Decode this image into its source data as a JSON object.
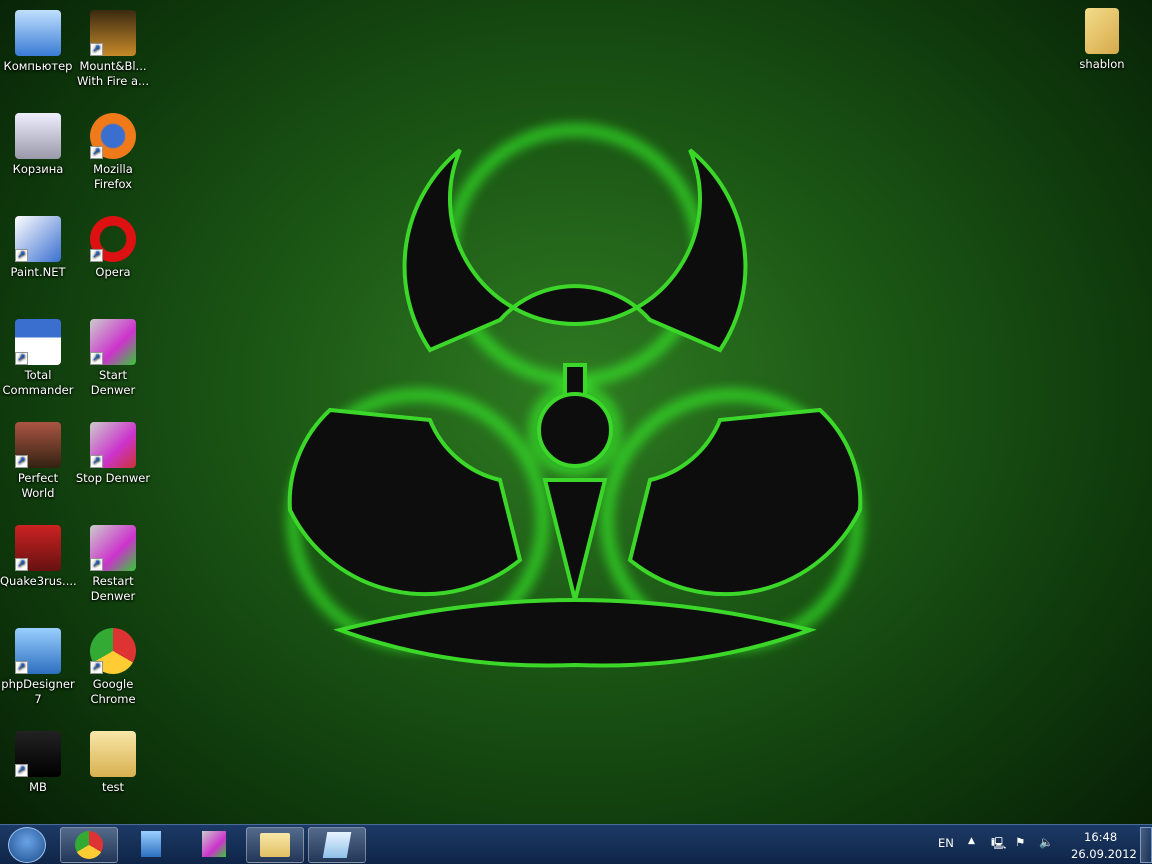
{
  "desktop": {
    "icons": [
      {
        "label": "Компьютер",
        "icon": "computer-icon",
        "col": 0,
        "row": 0
      },
      {
        "label": "Mount&Bl... With Fire a...",
        "icon": "mount-blade-fs-icon",
        "col": 1,
        "row": 0
      },
      {
        "label": "Корзина",
        "icon": "recycle-bin-icon",
        "col": 0,
        "row": 1
      },
      {
        "label": "Mozilla Firefox",
        "icon": "firefox-icon",
        "col": 1,
        "row": 1
      },
      {
        "label": "Paint.NET",
        "icon": "paintnet-icon",
        "col": 0,
        "row": 2
      },
      {
        "label": "Opera",
        "icon": "opera-icon",
        "col": 1,
        "row": 2
      },
      {
        "label": "Total Commander",
        "icon": "total-commander-icon",
        "col": 0,
        "row": 3
      },
      {
        "label": "Start Denwer",
        "icon": "denwer-start-icon",
        "col": 1,
        "row": 3
      },
      {
        "label": "Perfect World",
        "icon": "perfect-world-icon",
        "col": 0,
        "row": 4
      },
      {
        "label": "Stop Denwer",
        "icon": "denwer-stop-icon",
        "col": 1,
        "row": 4
      },
      {
        "label": "Quake3rus....",
        "icon": "quake3-icon",
        "col": 0,
        "row": 5
      },
      {
        "label": "Restart Denwer",
        "icon": "denwer-restart-icon",
        "col": 1,
        "row": 5
      },
      {
        "label": "phpDesigner 7",
        "icon": "phpdesigner-icon",
        "col": 0,
        "row": 6
      },
      {
        "label": "Google Chrome",
        "icon": "chrome-icon",
        "col": 1,
        "row": 6
      },
      {
        "label": "MB",
        "icon": "mb-icon",
        "col": 0,
        "row": 7
      },
      {
        "label": "test",
        "icon": "folder-icon",
        "col": 1,
        "row": 7
      }
    ],
    "right_icon": {
      "label": "shablon",
      "icon": "folder-documents-icon"
    }
  },
  "taskbar": {
    "pinned": [
      "chrome",
      "phpdesigner",
      "denwer",
      "explorer",
      "notepad"
    ],
    "language": "EN",
    "time": "16:48",
    "date": "26.09.2012"
  },
  "colors": {
    "glow": "#39ff2a",
    "taskbar": "#16305a"
  }
}
